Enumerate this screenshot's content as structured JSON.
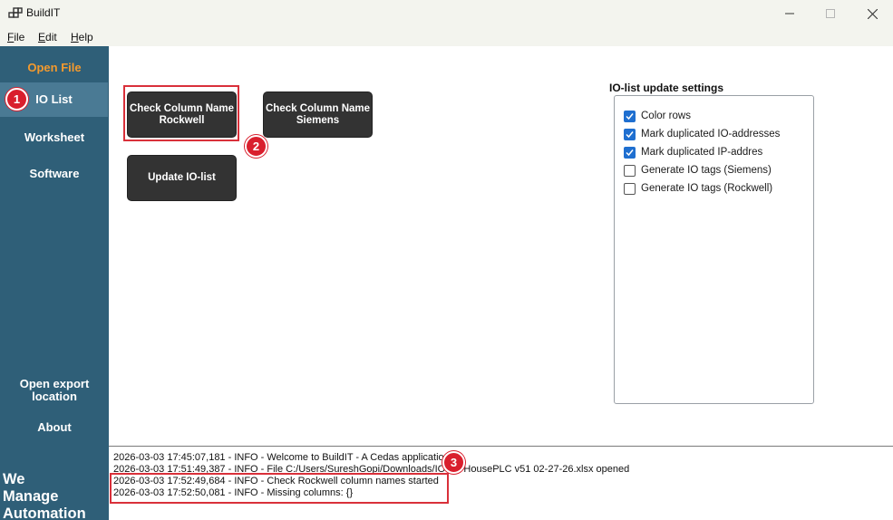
{
  "window": {
    "title": "BuildIT",
    "minimize_icon": "minimize-icon",
    "maximize_icon": "maximize-icon",
    "close_icon": "close-icon"
  },
  "menu": {
    "items": [
      "File",
      "Edit",
      "Help"
    ]
  },
  "sidebar": {
    "open_file": "Open File",
    "io_list": "IO List",
    "worksheet": "Worksheet",
    "software": "Software",
    "open_export_line1": "Open export",
    "open_export_line2": "location",
    "about": "About",
    "tagline": [
      "We",
      "Manage",
      "Automation"
    ],
    "accent_color": "#f39a2e",
    "background_color": "#2f5f78",
    "active_color": "#4a7a94"
  },
  "buttons": {
    "rockwell_line1": "Check Column Name",
    "rockwell_line2": "Rockwell",
    "siemens_line1": "Check Column Name",
    "siemens_line2": "Siemens",
    "update": "Update IO-list"
  },
  "settings": {
    "title": "IO-list update settings",
    "options": [
      {
        "label": "Color rows",
        "checked": true
      },
      {
        "label": "Mark duplicated IO-addresses",
        "checked": true
      },
      {
        "label": "Mark duplicated IP-addres",
        "checked": true
      },
      {
        "label": "Generate IO tags (Siemens)",
        "checked": false
      },
      {
        "label": "Generate IO tags (Rockwell)",
        "checked": false
      }
    ]
  },
  "log": {
    "lines": [
      "2026-03-03 17:45:07,181 - INFO - Welcome to BuildIT - A Cedas application",
      "2026-03-03 17:51:49,387 - INFO - File C:/Users/SureshGopi/Downloads/IO-list HousePLC v51 02-27-26.xlsx opened",
      "2026-03-03 17:52:49,684 - INFO - Check Rockwell column names started",
      "2026-03-03 17:52:50,081 - INFO - Missing columns: {}"
    ]
  },
  "annotations": {
    "markers": [
      "1",
      "2",
      "3"
    ],
    "color": "#d91f2d"
  }
}
